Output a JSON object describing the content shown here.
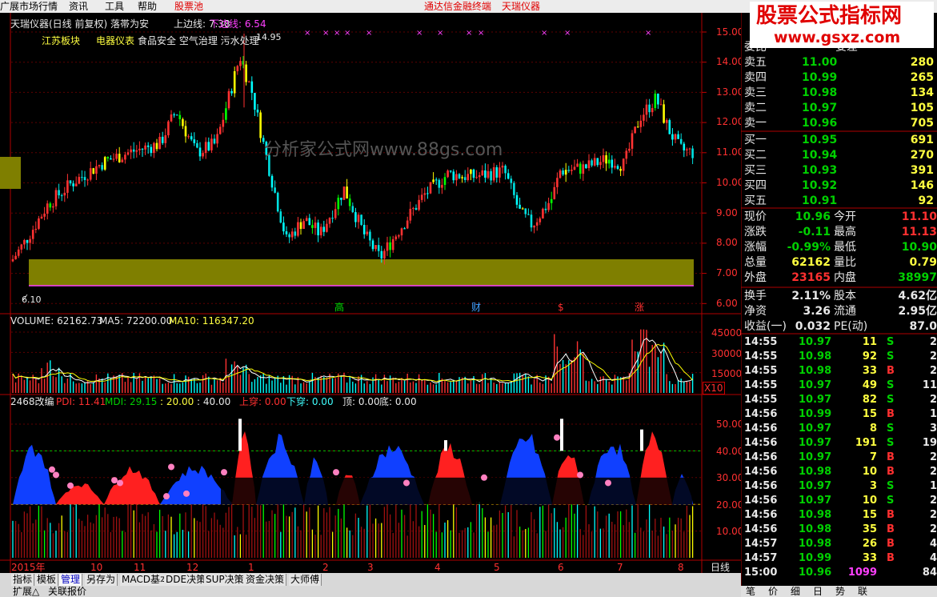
{
  "menubar": {
    "items": [
      "广展市场行情",
      "资讯",
      "工具",
      "帮助"
    ],
    "pool": "股票池",
    "tongda": "通达信金融终端",
    "stock": "天瑞仪器",
    "icons": [
      "restore-icon",
      "close-icon"
    ]
  },
  "main": {
    "title": "天瑞仪器(日线 前复权) 落帯为安",
    "upper_label": "上边线: 7.38",
    "lower_label": "下边线: 6.54",
    "sector_a": "江苏板块",
    "sector_b": "电器仪表",
    "sector_c": "食品安全 空气治理 污水处理",
    "high_label": "14.95",
    "low_label": "6.10",
    "site_watermark": "分析家公式网www.88gs.com",
    "markers": [
      "高",
      "财",
      "$",
      "涨"
    ],
    "price_ticks": [
      "15.00",
      "14.00",
      "13.00",
      "12.00",
      "11.00",
      "10.00",
      "9.00",
      "8.00",
      "7.00",
      "6.00"
    ]
  },
  "volume": {
    "label": "VOLUME: 62162.73",
    "ma5": "MA5: 72200.00",
    "ma10": "MA10: 116347.20",
    "ticks": [
      "45000",
      "30000",
      "15000"
    ],
    "unit": "X10"
  },
  "indicator": {
    "name": "2468改编",
    "pdi": "PDI: 11.41",
    "mdi": "MDI: 29.15",
    "l20": ": 20.00",
    "l40": ": 40.00",
    "up": "上穿: 0.00",
    "down": "下穿: 0.00",
    "top": "顶: 0.00",
    "bottom": "底: 0.00",
    "ticks": [
      "50.00",
      "40.00",
      "30.00",
      "20.00",
      "10.00"
    ]
  },
  "xaxis": {
    "labels": [
      "2015年",
      "10",
      "11",
      "12",
      "1",
      "2",
      "3",
      "4",
      "5",
      "6",
      "7",
      "8"
    ],
    "period": "日线"
  },
  "tabs": [
    "指标",
    "模板",
    "管理",
    "另存为",
    "MACD基本",
    "DDE决策",
    "SUP决策",
    "资金决策",
    "大师傅"
  ],
  "tabs2": [
    "扩展△",
    "关联报价"
  ],
  "watermark": {
    "title": "股票公式指标网",
    "url": "www.gsxz.com"
  },
  "orderbook": {
    "partial": {
      "label": "委比",
      "label2": "委差"
    },
    "asks": [
      {
        "label": "卖五",
        "price": "11.00",
        "vol": "280"
      },
      {
        "label": "卖四",
        "price": "10.99",
        "vol": "265"
      },
      {
        "label": "卖三",
        "price": "10.98",
        "vol": "134"
      },
      {
        "label": "卖二",
        "price": "10.97",
        "vol": "105"
      },
      {
        "label": "卖一",
        "price": "10.96",
        "vol": "705"
      }
    ],
    "bids": [
      {
        "label": "买一",
        "price": "10.95",
        "vol": "691"
      },
      {
        "label": "买二",
        "price": "10.94",
        "vol": "270"
      },
      {
        "label": "买三",
        "price": "10.93",
        "vol": "391"
      },
      {
        "label": "买四",
        "price": "10.92",
        "vol": "146"
      },
      {
        "label": "买五",
        "price": "10.91",
        "vol": "92"
      }
    ]
  },
  "stats": [
    {
      "l1": "现价",
      "v1": "10.96",
      "l2": "今开",
      "v2": "11.10"
    },
    {
      "l1": "涨跌",
      "v1": "-0.11",
      "l2": "最高",
      "v2": "11.13"
    },
    {
      "l1": "涨幅",
      "v1": "-0.99%",
      "l2": "最低",
      "v2": "10.90"
    },
    {
      "l1": "总量",
      "v1": "62162",
      "l2": "量比",
      "v2": "0.79"
    },
    {
      "l1": "外盘",
      "v1": "23165",
      "l2": "内盘",
      "v2": "38997"
    },
    {
      "l1": "换手",
      "v1": "2.11%",
      "l2": "股本",
      "v2": "4.62亿"
    },
    {
      "l1": "净资",
      "v1": "3.26",
      "l2": "流通",
      "v2": "2.95亿"
    },
    {
      "l1": "收益(一)",
      "v1": "0.032",
      "l2": "PE(动)",
      "v2": "87.0"
    }
  ],
  "trades": [
    {
      "t": "14:55",
      "p": "10.97",
      "v": "11",
      "s": "S",
      "n": "2"
    },
    {
      "t": "14:55",
      "p": "10.98",
      "v": "92",
      "s": "S",
      "n": "2"
    },
    {
      "t": "14:55",
      "p": "10.98",
      "v": "33",
      "s": "B",
      "n": "2"
    },
    {
      "t": "14:55",
      "p": "10.97",
      "v": "49",
      "s": "S",
      "n": "11"
    },
    {
      "t": "14:55",
      "p": "10.97",
      "v": "82",
      "s": "S",
      "n": "2"
    },
    {
      "t": "14:56",
      "p": "10.99",
      "v": "15",
      "s": "B",
      "n": "1"
    },
    {
      "t": "14:56",
      "p": "10.97",
      "v": "8",
      "s": "S",
      "n": "3"
    },
    {
      "t": "14:56",
      "p": "10.97",
      "v": "191",
      "s": "S",
      "n": "19"
    },
    {
      "t": "14:56",
      "p": "10.97",
      "v": "7",
      "s": "B",
      "n": "2"
    },
    {
      "t": "14:56",
      "p": "10.98",
      "v": "10",
      "s": "B",
      "n": "2"
    },
    {
      "t": "14:56",
      "p": "10.97",
      "v": "3",
      "s": "S",
      "n": "1"
    },
    {
      "t": "14:56",
      "p": "10.97",
      "v": "10",
      "s": "S",
      "n": "2"
    },
    {
      "t": "14:56",
      "p": "10.98",
      "v": "15",
      "s": "B",
      "n": "2"
    },
    {
      "t": "14:56",
      "p": "10.98",
      "v": "35",
      "s": "B",
      "n": "2"
    },
    {
      "t": "14:57",
      "p": "10.98",
      "v": "26",
      "s": "B",
      "n": "4"
    },
    {
      "t": "14:57",
      "p": "10.99",
      "v": "33",
      "s": "B",
      "n": "4"
    },
    {
      "t": "15:00",
      "p": "10.96",
      "v": "1099",
      "s": "",
      "n": "84"
    }
  ],
  "sidetabs": [
    "笔",
    "价",
    "细",
    "日",
    "势",
    "联"
  ],
  "colors": {
    "rise": "#ff3232",
    "fall": "#00d200",
    "yellow": "#ffff00",
    "band": "#7f7f00",
    "grid": "#8b0000"
  }
}
